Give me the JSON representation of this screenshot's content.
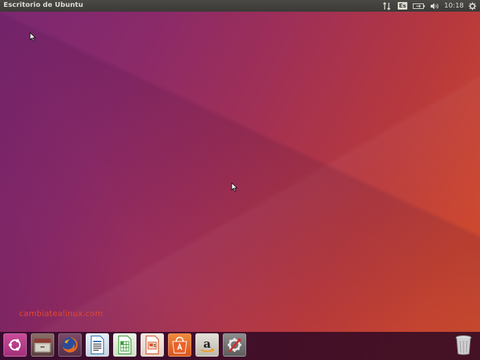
{
  "top_panel": {
    "title": "Escritorio de Ubuntu",
    "keyboard_layout": "Es",
    "clock": "10:18",
    "indicators": [
      "network-updown-icon",
      "keyboard-layout-indicator",
      "battery-icon",
      "volume-icon",
      "clock",
      "gear-icon"
    ]
  },
  "desktop": {
    "watermark": "cambiatealinux.com",
    "wallpaper_colors": [
      "#7a2772",
      "#9e2f57",
      "#cc472f"
    ]
  },
  "launcher": {
    "items": [
      {
        "name": "ubuntu-dash",
        "icon": "ubuntu-logo-icon",
        "color": "#c5408e"
      },
      {
        "name": "files",
        "icon": "file-cabinet-icon",
        "color": "#a9a497"
      },
      {
        "name": "firefox",
        "icon": "firefox-icon",
        "color": "#e66a1e"
      },
      {
        "name": "libreoffice-writer",
        "icon": "writer-document-icon",
        "color": "#2a73b7"
      },
      {
        "name": "libreoffice-calc",
        "icon": "calc-spreadsheet-icon",
        "color": "#3c9b3c"
      },
      {
        "name": "libreoffice-impress",
        "icon": "impress-presentation-icon",
        "color": "#d3572a"
      },
      {
        "name": "ubuntu-software",
        "icon": "shopping-bag-icon",
        "color": "#e0652a"
      },
      {
        "name": "amazon",
        "icon": "amazon-icon",
        "color": "#c9c4b8"
      },
      {
        "name": "system-settings",
        "icon": "settings-wrench-icon",
        "color": "#8a8a8a"
      }
    ],
    "trash_icon": "trash-icon"
  }
}
